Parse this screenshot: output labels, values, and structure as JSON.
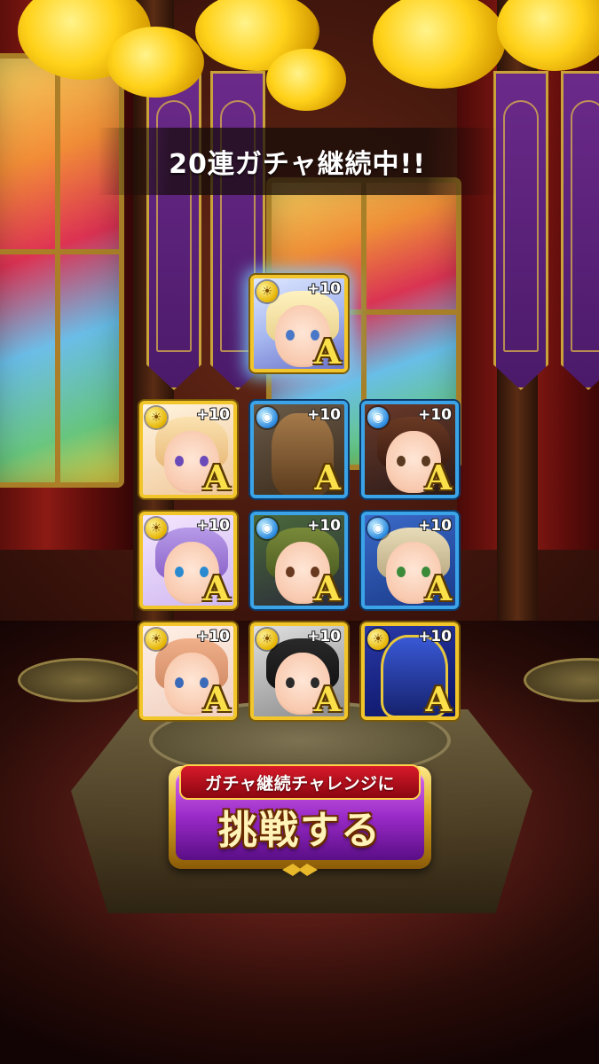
{
  "header": {
    "title": "20連ガチャ継続中!!"
  },
  "featured_unit": {
    "attribute": "sun",
    "plus": "+10",
    "rank": "A",
    "frame": "gold",
    "highlight_color": "#7fd6ff"
  },
  "units": [
    {
      "attribute": "sun",
      "plus": "+10",
      "rank": "A",
      "frame": "gold"
    },
    {
      "attribute": "water",
      "plus": "+10",
      "rank": "A",
      "frame": "blue"
    },
    {
      "attribute": "water",
      "plus": "+10",
      "rank": "A",
      "frame": "blue"
    },
    {
      "attribute": "sun",
      "plus": "+10",
      "rank": "A",
      "frame": "gold"
    },
    {
      "attribute": "water",
      "plus": "+10",
      "rank": "A",
      "frame": "blue"
    },
    {
      "attribute": "water",
      "plus": "+10",
      "rank": "A",
      "frame": "blue"
    },
    {
      "attribute": "sun",
      "plus": "+10",
      "rank": "A",
      "frame": "gold"
    },
    {
      "attribute": "sun",
      "plus": "+10",
      "rank": "A",
      "frame": "gold"
    },
    {
      "attribute": "sun",
      "plus": "+10",
      "rank": "A",
      "frame": "gold"
    }
  ],
  "challenge_button": {
    "ribbon_label": "ガチャ継続チャレンジに",
    "main_label": "挑戦する"
  },
  "colors": {
    "gold_frame": "#f2c62a",
    "blue_frame": "#3ba4e8",
    "button_purple": "#9a2ac8",
    "ribbon_red": "#d81a2a"
  }
}
